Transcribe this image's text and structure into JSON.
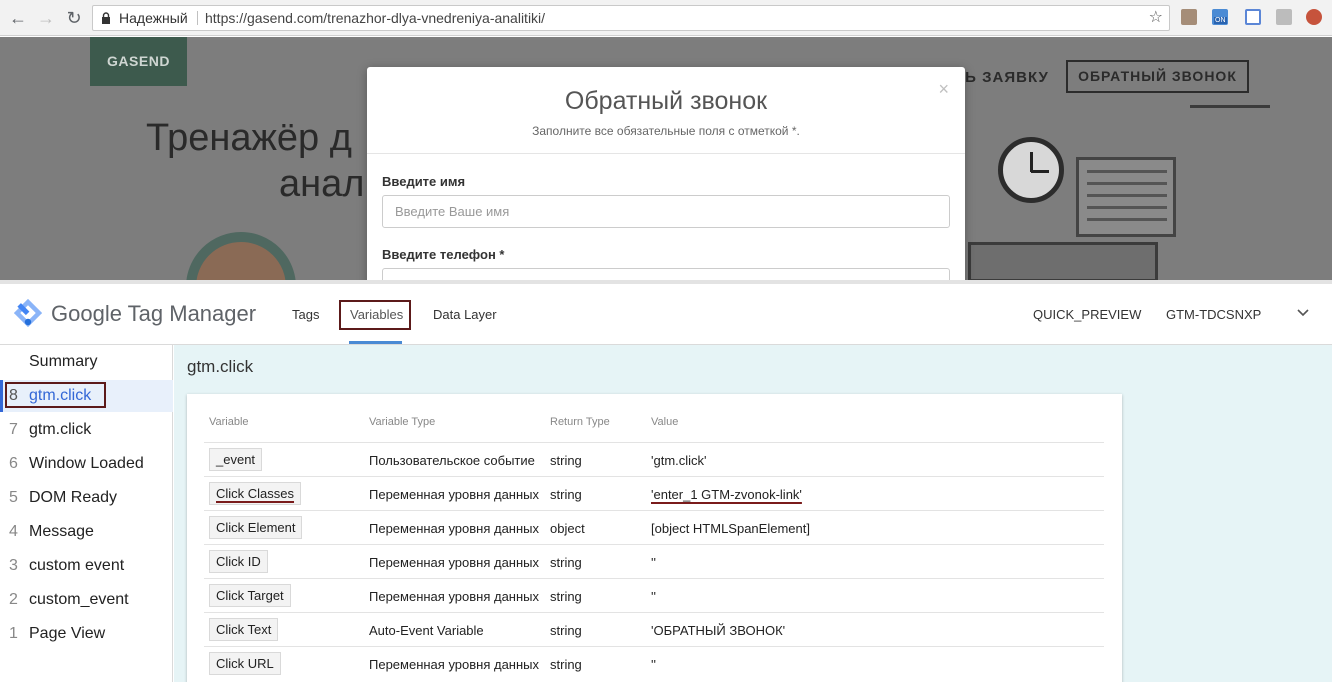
{
  "browser": {
    "secure_label": "Надежный",
    "url": "https://gasend.com/trenazhor-dlya-vnedreniya-analitiki/",
    "ext_badge": "ON"
  },
  "site": {
    "logo_text": "GASEND",
    "nav_link": "ТЬ ЗАЯВКУ",
    "nav_button": "ОБРАТНЫЙ ЗВОНОК",
    "hero_line1": "Тренажёр д",
    "hero_line2": "анал"
  },
  "modal": {
    "close": "×",
    "title": "Обратный звонок",
    "subtitle": "Заполните все обязательные поля с отметкой *.",
    "field1_label": "Введите имя",
    "field1_placeholder": "Введите Ваше имя",
    "field2_label": "Введите телефон *"
  },
  "gtm": {
    "brand": "Google Tag Manager",
    "tabs": [
      "Tags",
      "Variables",
      "Data Layer"
    ],
    "quick_preview": "QUICK_PREVIEW",
    "container_id": "GTM-TDCSNXP",
    "summary_label": "Summary",
    "events": [
      {
        "num": "8",
        "label": "gtm.click"
      },
      {
        "num": "7",
        "label": "gtm.click"
      },
      {
        "num": "6",
        "label": "Window Loaded"
      },
      {
        "num": "5",
        "label": "DOM Ready"
      },
      {
        "num": "4",
        "label": "Message"
      },
      {
        "num": "3",
        "label": "custom event"
      },
      {
        "num": "2",
        "label": "custom_event"
      },
      {
        "num": "1",
        "label": "Page View"
      }
    ],
    "event_title": "gtm.click",
    "table": {
      "headers": [
        "Variable",
        "Variable Type",
        "Return Type",
        "Value"
      ],
      "rows": [
        {
          "variable": "_event",
          "type": "Пользовательское событие",
          "return": "string",
          "value": "'gtm.click'"
        },
        {
          "variable": "Click Classes",
          "type": "Переменная уровня данных",
          "return": "string",
          "value": "'enter_1 GTM-zvonok-link'"
        },
        {
          "variable": "Click Element",
          "type": "Переменная уровня данных",
          "return": "object",
          "value": "[object HTMLSpanElement]"
        },
        {
          "variable": "Click ID",
          "type": "Переменная уровня данных",
          "return": "string",
          "value": "''"
        },
        {
          "variable": "Click Target",
          "type": "Переменная уровня данных",
          "return": "string",
          "value": "''"
        },
        {
          "variable": "Click Text",
          "type": "Auto-Event Variable",
          "return": "string",
          "value": "'ОБРАТНЫЙ ЗВОНОК'"
        },
        {
          "variable": "Click URL",
          "type": "Переменная уровня данных",
          "return": "string",
          "value": "''"
        }
      ]
    }
  },
  "colors": {
    "accent_blue": "#3367d6",
    "highlight_outline": "#5c1a1a",
    "main_bg": "#e6f4f6"
  }
}
